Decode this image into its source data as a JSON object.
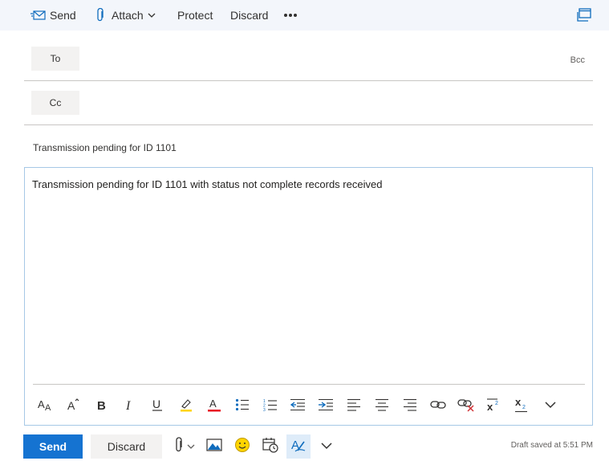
{
  "toolbar": {
    "send_label": "Send",
    "attach_label": "Attach",
    "protect_label": "Protect",
    "discard_label": "Discard",
    "more_icon": "ellipsis-icon",
    "popout_icon": "popout-window-icon"
  },
  "recipients": {
    "to_label": "To",
    "cc_label": "Cc",
    "bcc_label": "Bcc",
    "to_value": "",
    "cc_value": ""
  },
  "subject": {
    "value": "Transmission pending for ID 1101"
  },
  "body": {
    "text": "Transmission pending for ID 1101 with status not complete records received"
  },
  "format_toolbar": {
    "icons": [
      "font-size-icon",
      "grow-font-icon",
      "bold-icon",
      "italic-icon",
      "underline-icon",
      "highlight-icon",
      "font-color-icon",
      "bullets-icon",
      "numbering-icon",
      "decrease-indent-icon",
      "increase-indent-icon",
      "align-left-icon",
      "align-center-icon",
      "align-right-icon",
      "insert-link-icon",
      "remove-link-icon",
      "superscript-icon",
      "subscript-icon",
      "more-options-icon"
    ],
    "highlight_color": "#ffd400",
    "font_color": "#e81123"
  },
  "actions": {
    "send_label": "Send",
    "discard_label": "Discard",
    "draft_status": "Draft saved at 5:51 PM",
    "icons": [
      "attach-icon",
      "insert-picture-icon",
      "emoji-icon",
      "schedule-send-icon",
      "editor-icon",
      "chevron-down-icon"
    ]
  },
  "colors": {
    "accent": "#1573d1",
    "toolbar_bg": "#f3f6fb",
    "icon_blue": "#0f6cbd"
  }
}
